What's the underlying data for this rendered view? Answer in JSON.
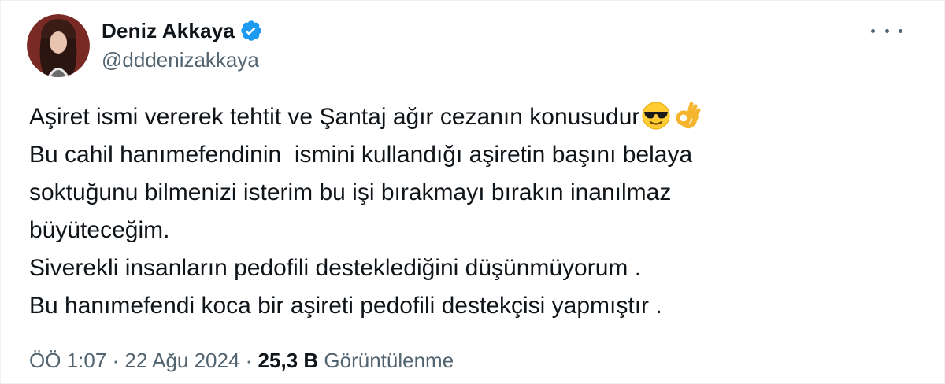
{
  "author": {
    "display_name": "Deniz Akkaya",
    "handle": "@dddenizakkaya",
    "verified": true,
    "verified_color": "#1d9bf0"
  },
  "tweet": {
    "lines": [
      "Aşiret ismi vererek tehtit ve Şantaj ağır cezanın konusudur",
      "Bu cahil hanımefendinin  ismini kullandığı aşiretin başını belaya",
      "soktuğunu bilmenizi isterim bu işi bırakmayı bırakın inanılmaz",
      "büyüteceğim.",
      "Siverekli insanların pedofili desteklediğini düşünmüyorum .",
      "Bu hanımefendi koca bir aşireti pedofili destekçisi yapmıştır ."
    ],
    "first_line_emojis": [
      "smiling-face-with-sunglasses",
      "ok-hand"
    ]
  },
  "meta": {
    "time": "ÖÖ 1:07",
    "separator": " · ",
    "date": "22 Ağu 2024",
    "views_count": "25,3 B",
    "views_label": "Görüntülenme"
  },
  "colors": {
    "text": "#0f1419",
    "secondary": "#536471",
    "background": "#ffffff"
  }
}
